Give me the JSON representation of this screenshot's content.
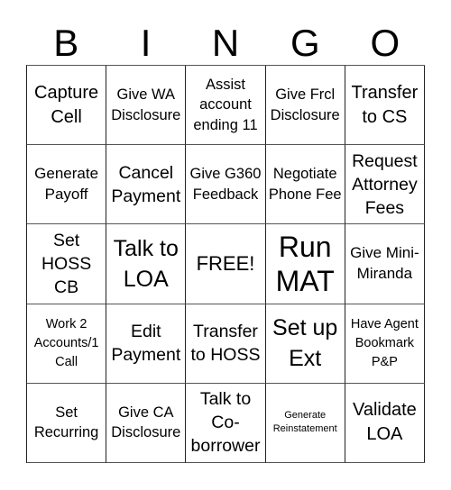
{
  "title_letters": [
    "B",
    "I",
    "N",
    "G",
    "O"
  ],
  "cells": [
    [
      {
        "text": "Capture Cell",
        "size": "s20"
      },
      {
        "text": "Give WA Disclosure",
        "size": "s16"
      },
      {
        "text": "Assist account ending 11",
        "size": "s16"
      },
      {
        "text": "Give Frcl Disclosure",
        "size": "s16"
      },
      {
        "text": "Transfer to CS",
        "size": "s20"
      }
    ],
    [
      {
        "text": "Generate Payoff",
        "size": "s17"
      },
      {
        "text": "Cancel Payment",
        "size": "s19"
      },
      {
        "text": "Give G360 Feedback",
        "size": "s16"
      },
      {
        "text": "Negotiate Phone Fee",
        "size": "s16"
      },
      {
        "text": "Request Attorney Fees",
        "size": "s19"
      }
    ],
    [
      {
        "text": "Set HOSS CB",
        "size": "s19"
      },
      {
        "text": "Talk to LOA",
        "size": "s25"
      },
      {
        "text": "FREE!",
        "size": "s22"
      },
      {
        "text": "Run MAT",
        "size": "s32"
      },
      {
        "text": "Give Mini-Miranda",
        "size": "s17"
      }
    ],
    [
      {
        "text": "Work 2 Accounts/1 Call",
        "size": "s14"
      },
      {
        "text": "Edit Payment",
        "size": "s19"
      },
      {
        "text": "Transfer to HOSS",
        "size": "s19"
      },
      {
        "text": "Set up Ext",
        "size": "s25"
      },
      {
        "text": "Have Agent Bookmark P&P",
        "size": "s14"
      }
    ],
    [
      {
        "text": "Set Recurring",
        "size": "s16"
      },
      {
        "text": "Give CA Disclosure",
        "size": "s16"
      },
      {
        "text": "Talk to Co-borrower",
        "size": "s19"
      },
      {
        "text": "Generate Reinstatement",
        "size": "s11"
      },
      {
        "text": "Validate LOA",
        "size": "s20"
      }
    ]
  ]
}
